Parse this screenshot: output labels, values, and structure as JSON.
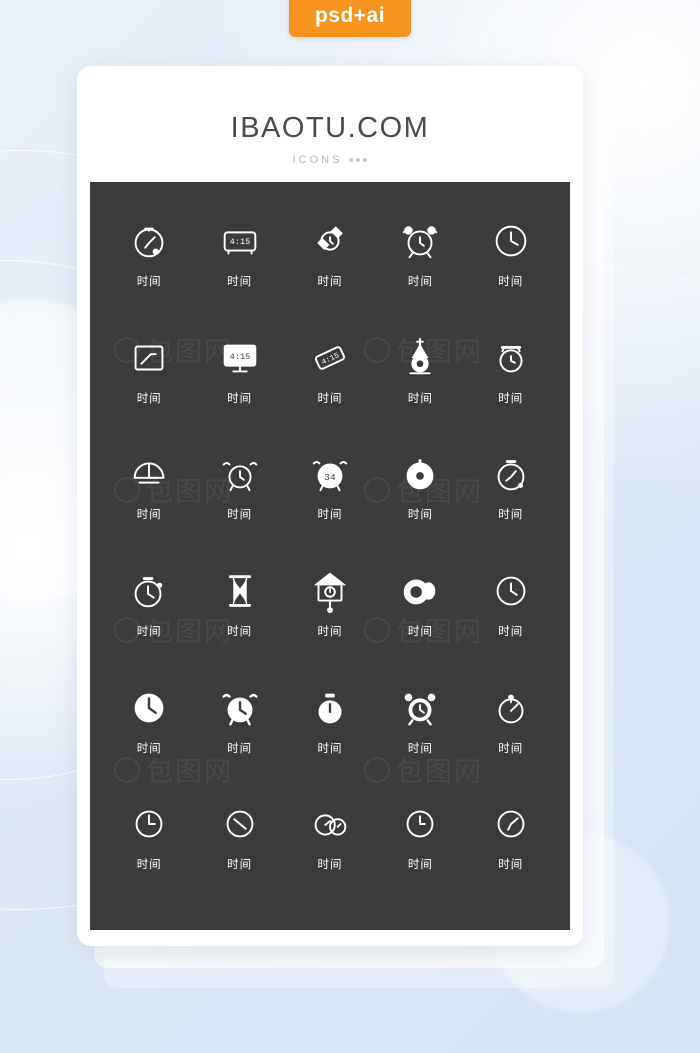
{
  "tag": {
    "label": "psd+ai",
    "color": "#f7941e"
  },
  "card": {
    "title": "IBAOTU.COM",
    "subtitle": "ICONS"
  },
  "panel": {
    "background": "#3b3b3b",
    "label_color": "#ffffff",
    "watermark": "包图网",
    "icons": [
      {
        "name": "stopwatch-dial",
        "label": "时间"
      },
      {
        "name": "digital-clock-radio",
        "label": "时间",
        "display": "4:15"
      },
      {
        "name": "wristwatch",
        "label": "时间"
      },
      {
        "name": "alarm-clock-twin-bell",
        "label": "时间"
      },
      {
        "name": "wall-clock-round",
        "label": "时间"
      },
      {
        "name": "square-clock",
        "label": "时间"
      },
      {
        "name": "desktop-monitor-clock",
        "label": "时间",
        "display": "4:15"
      },
      {
        "name": "digital-display-tilted",
        "label": "时间",
        "display": "4:15"
      },
      {
        "name": "grandfather-pendulum-clock",
        "label": "时间"
      },
      {
        "name": "alarm-clock-small",
        "label": "时间"
      },
      {
        "name": "sundial-clock",
        "label": "时间"
      },
      {
        "name": "alarm-clock-bells",
        "label": "时间"
      },
      {
        "name": "alarm-clock-digital-face",
        "label": "时间",
        "display": "34"
      },
      {
        "name": "pocket-watch-round",
        "label": "时间"
      },
      {
        "name": "stopwatch-side-button",
        "label": "时间"
      },
      {
        "name": "stopwatch-crown",
        "label": "时间"
      },
      {
        "name": "hourglass",
        "label": "时间"
      },
      {
        "name": "cuckoo-clock",
        "label": "时间"
      },
      {
        "name": "clock-with-bell",
        "label": "时间"
      },
      {
        "name": "clock-thin-frame",
        "label": "时间"
      },
      {
        "name": "clock-solid-circle",
        "label": "时间"
      },
      {
        "name": "alarm-clock-solid",
        "label": "时间"
      },
      {
        "name": "stopwatch-solid",
        "label": "时间"
      },
      {
        "name": "alarm-clock-classic",
        "label": "时间"
      },
      {
        "name": "timer-dial-knob",
        "label": "时间"
      },
      {
        "name": "clock-outline-round",
        "label": "时间"
      },
      {
        "name": "clock-outline-thin",
        "label": "时间"
      },
      {
        "name": "double-clock-overlap",
        "label": "时间"
      },
      {
        "name": "clock-simple",
        "label": "时间"
      },
      {
        "name": "clock-tilted-hands",
        "label": "时间"
      }
    ]
  }
}
